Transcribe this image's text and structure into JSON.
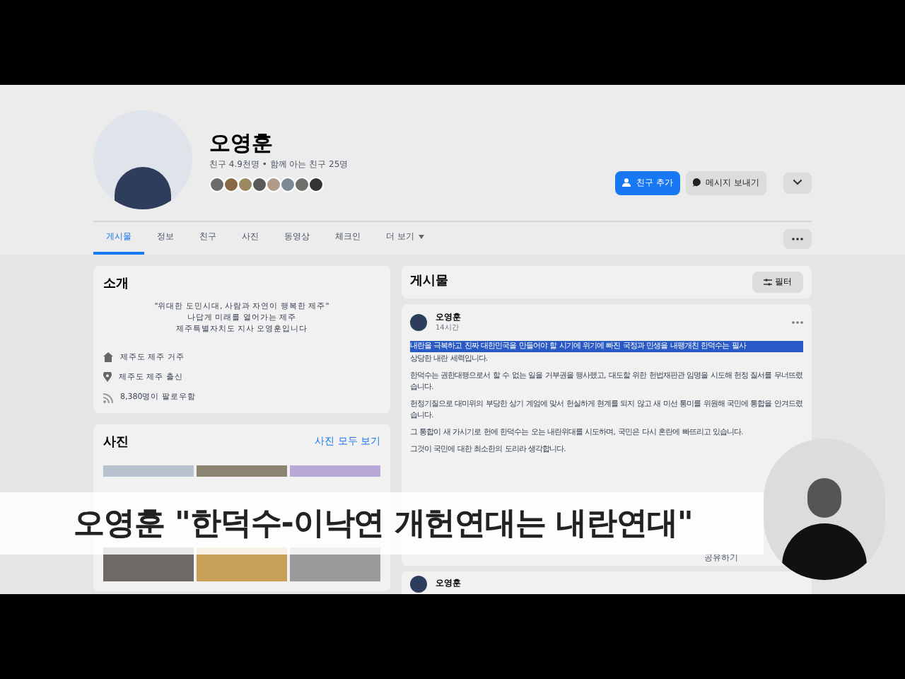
{
  "profile": {
    "name": "오영훈",
    "stats": "친구 4.9천명 • 함께 아는 친구 25명",
    "buttons": [
      {
        "kind": "primary",
        "label": "친구 추가"
      },
      {
        "kind": "secondary",
        "label": "메시지 보내기"
      }
    ]
  },
  "tabs": [
    {
      "label": "게시물",
      "selected": true
    },
    {
      "label": "정보",
      "selected": false
    },
    {
      "label": "친구",
      "selected": false
    },
    {
      "label": "사진",
      "selected": false
    },
    {
      "label": "동영상",
      "selected": false
    },
    {
      "label": "체크인",
      "selected": false
    },
    {
      "label": "더 보기",
      "selected": false
    }
  ],
  "intro": {
    "title": "소개",
    "bio": [
      "\"위대한 도민시대, 사람과 자연이 행복한 제주\"",
      "나답게 미래를 열어가는 제주",
      "제주특별자치도 지사 오영훈입니다"
    ],
    "details": [
      {
        "kind": "home",
        "text": "제주도 제주 거주"
      },
      {
        "kind": "place",
        "text": "제주도 제주 출신"
      },
      {
        "kind": "feed",
        "text": "8,380명이 팔로우함"
      }
    ]
  },
  "photos": {
    "title": "사진",
    "link": "사진 모두 보기"
  },
  "posts": {
    "title": "게시물",
    "filter": "필터",
    "author": "오영훈",
    "time": "14시간",
    "highlighted": "내란을 극복하고 진짜 대한민국을 만들어야 할 시기에 위기에 빠진 국정과 민생을 내팽개친 한덕수는 필사",
    "lines": [
      "상당한 내란 세력입니다.",
      "한덕수는 권한대행으로서 할 수 없는 일을 거부권을 행사했고, 대도할 위한 헌법재판관 임명을 시도해 헌정 질서를 무너뜨렸습니다.",
      "헌정기질으로 대미위의 부당한 상기 계엄에 맞서 헌실하게 현계를 되지 않고 새 미선 통미를 위원해 국민에 통합을 안겨드렸습니다.",
      "그 통합이 새 가시기로 헌에 한덕수는 오는 내란위대를 시도하며, 국민은 다시 혼란에 빠뜨리고 있습니다.",
      "그것이 국민에 대한 최소한의 도리라 생각합니다."
    ],
    "share": "공유하기",
    "next_author": "오영훈"
  },
  "caption": "오영훈 \"한덕수-이낙연 개헌연대는 내란연대\""
}
